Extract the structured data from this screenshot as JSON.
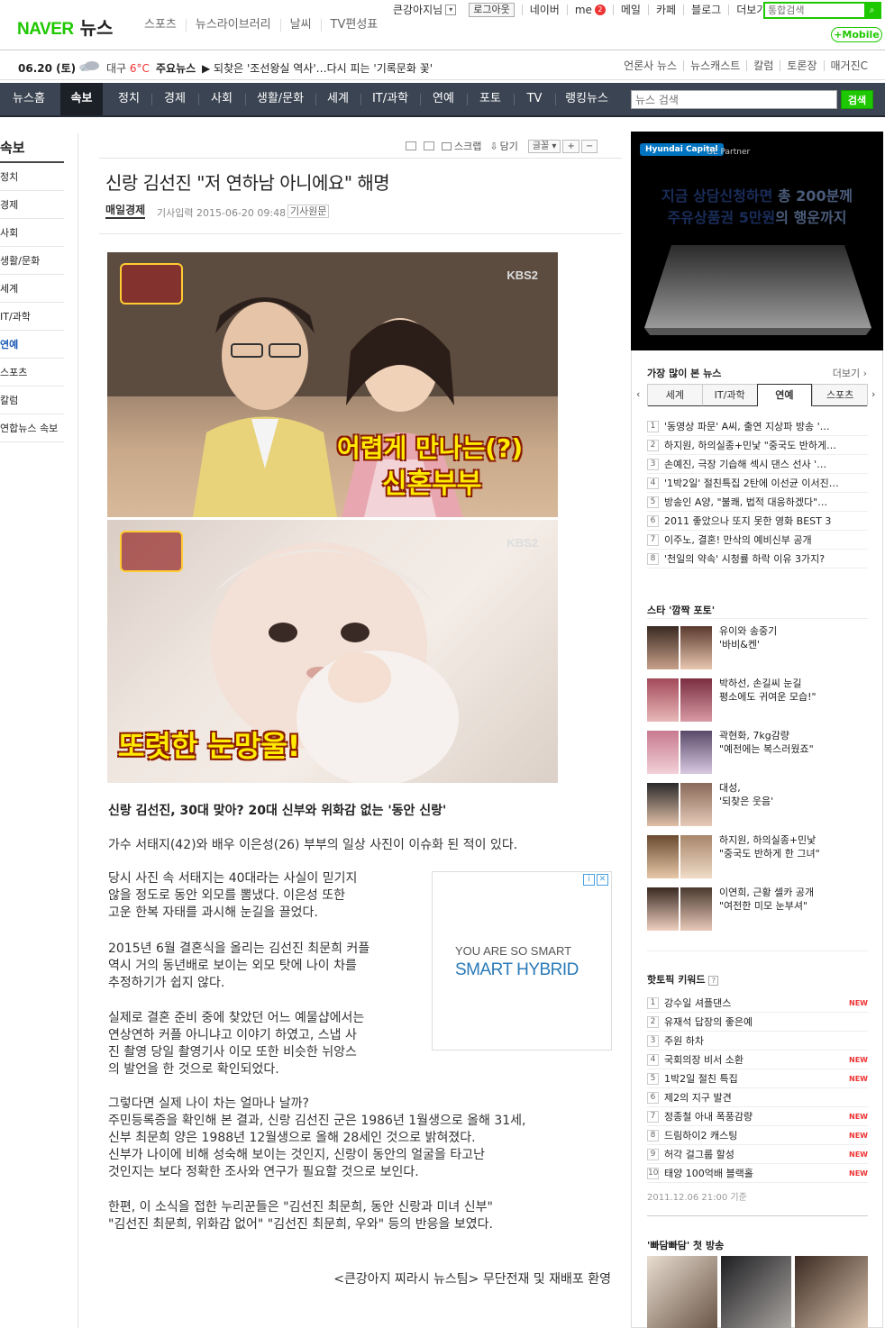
{
  "header": {
    "logo": "NAVER",
    "section": "뉴스",
    "services": [
      "스포츠",
      "뉴스라이브러리",
      "날씨",
      "TV편성표"
    ],
    "user": "큰강아지님",
    "logout": "로그아웃",
    "links": [
      "네이버",
      "me",
      "메일",
      "카페",
      "블로그",
      "더보기"
    ],
    "me_count": "2",
    "search_placeholder": "통합검색",
    "mobile": "+Mobile"
  },
  "subbar": {
    "date": "06.20 (토)",
    "weather_city": "대구",
    "weather_temp": "6°C",
    "major_label": "주요뉴스",
    "major_text": "되찾은 '조선왕실 역사'…다시 피는 '기록문화 꽃'",
    "links": [
      "언론사 뉴스",
      "뉴스캐스트",
      "칼럼",
      "토론장",
      "매거진C"
    ]
  },
  "nav": {
    "items": [
      "뉴스홈",
      "속보",
      "정치",
      "경제",
      "사회",
      "생활/문화",
      "세계",
      "IT/과학",
      "연예",
      "포토",
      "TV",
      "랭킹뉴스"
    ],
    "active": "속보",
    "search_placeholder": "뉴스 검색",
    "search_button": "검색"
  },
  "sidebar": {
    "title": "속보",
    "items": [
      "정치",
      "경제",
      "사회",
      "생활/문화",
      "세계",
      "IT/과학",
      "연예",
      "스포츠",
      "칼럼",
      "연합뉴스 속보"
    ],
    "active": "연예"
  },
  "tools": {
    "scrap": "스크랩",
    "save": "담기",
    "font": "글꼴",
    "plus": "+",
    "minus": "−"
  },
  "article": {
    "title": "신랑 김선진 \"저 연하남 아니에요\" 해명",
    "press": "매일경제",
    "input_time": "기사입력 2015-06-20 09:48",
    "original_button": "기사원문",
    "photo1_caption_line1": "어렵게 만나는(?)",
    "photo1_caption_line2": "신혼부부",
    "photo2_caption": "또렷한 눈망울!",
    "broadcaster": "KBS2",
    "subhead": "신랑 김선진, 30대 맞아? 20대 신부와 위화감 없는 '동안 신랑'",
    "p1": "가수 서태지(42)와 배우 이은성(26) 부부의 일상 사진이 이슈화 된 적이 있다.",
    "p2_l1": "당시 사진 속 서태지는 40대라는 사실이 믿기지",
    "p2_l2": "않을 정도로 동안 외모를 뽐냈다. 이은성 또한",
    "p2_l3": "고운 한복 자태를 과시해 눈길을 끌었다.",
    "p3_l1": "2015년 6월 결혼식을 올리는 김선진 최문희 커플",
    "p3_l2": "역시 거의 동년배로 보이는 외모 탓에 나이 차를",
    "p3_l3": "추정하기가 쉽지 않다.",
    "p4_l1": "실제로 결혼 준비 중에 찾았던 어느 예물샵에서는",
    "p4_l2": "연상연하 커플 아니냐고 이야기 하였고, 스냅 사",
    "p4_l3": "진 촬영 당일 촬영기사 이모 또한 비슷한 뉘앙스",
    "p4_l4": "의 발언을 한 것으로 확인되었다.",
    "p5_l1": "그렇다면 실제 나이 차는 얼마나 날까?",
    "p5_l2": "주민등록증을 확인해 본 결과, 신랑 김선진 군은 1986년 1월생으로 올해 31세,",
    "p5_l3": "신부 최문희 양은 1988년 12월생으로 올해 28세인 것으로 밝혀졌다.",
    "p5_l4": "신부가 나이에 비해 성숙해 보이는 것인지, 신랑이 동안의 얼굴을 타고난",
    "p5_l5": "것인지는 보다 정확한 조사와 연구가 필요할 것으로 보인다.",
    "p6_l1": "한편, 이 소식을 접한 누리꾼들은 \"김선진 최문희, 동안 신랑과 미녀 신부\"",
    "p6_l2": "\"김선진 최문희, 위화감 없어\" \"김선진 최문희, 우와\" 등의 반응을 보였다.",
    "source": "<큰강아지 찌라시 뉴스팀> 무단전재 및 재배포 환영"
  },
  "ad": {
    "line1": "YOU ARE SO SMART",
    "line2": "SMART HYBRID"
  },
  "banner": {
    "brand": "Hyundai Capital",
    "partner": "GE Partner",
    "text1_a": "지금 상담신청하면",
    "text1_b": " 총 200분께",
    "text2_a": "주유상품권 5만원",
    "text2_b": "의 행운까지"
  },
  "most_viewed": {
    "title": "가장 많이 본 뉴스",
    "more": "더보기",
    "tabs": [
      "세계",
      "IT/과학",
      "연예",
      "스포츠"
    ],
    "active_tab": "연예",
    "items": [
      "'동영상 파문' A씨, 출연 지상파 방송 '…",
      "하지원, 하의실종+민낯 \"중국도 반하게…",
      "손예진, 극장 기습해 섹시 댄스 선사 '…",
      "'1박2일' 절친특집 2탄에 이선균 이서진…",
      "방송인 A양, \"불쾌, 법적 대응하겠다\"…",
      "2011 좋았으나 또지 못한 영화 BEST 3",
      "이주노, 결혼! 만삭의 예비신부 공개",
      "'천일의 약속' 시청률 하락 이유 3가지?"
    ]
  },
  "star_photo": {
    "title": "스타 '깜짝 포토'",
    "items": [
      {
        "l1": "유이와 송중기",
        "l2": "'바비&켄'"
      },
      {
        "l1": "박하선, 손길씨 눈길",
        "l2": "평소에도 귀여운 모습!\""
      },
      {
        "l1": "곽현화, 7kg감량",
        "l2": "\"예전에는 복스러웠죠\""
      },
      {
        "l1": "대성,",
        "l2": "'되찾은 웃음'"
      },
      {
        "l1": "하지원, 하의실종+민낯",
        "l2": "\"중국도 반하게 한 그녀\""
      },
      {
        "l1": "이연희, 근황 셀카 공개",
        "l2": "\"여전한 미모 눈부셔\""
      }
    ]
  },
  "hot_topic": {
    "title": "핫토픽 키워드",
    "items": [
      {
        "t": "강수일 셔플댄스",
        "new": true
      },
      {
        "t": "유재석 답장의 좋은예",
        "new": false
      },
      {
        "t": "주원 하차",
        "new": false
      },
      {
        "t": "국회의장 비서 소환",
        "new": true
      },
      {
        "t": "1박2일 절친 특집",
        "new": true
      },
      {
        "t": "제2의 지구 발견",
        "new": false
      },
      {
        "t": "정종철 아내 폭풍감량",
        "new": true
      },
      {
        "t": "드림하이2 캐스팅",
        "new": true
      },
      {
        "t": "허각 걸그룹 할성",
        "new": true
      },
      {
        "t": "태양 100억배 블랙홀",
        "new": true
      }
    ],
    "new_label": "NEW",
    "timestamp": "2011.12.06 21:00 기준"
  },
  "bbadam": {
    "title": "'빠담빠담' 첫 방송"
  }
}
